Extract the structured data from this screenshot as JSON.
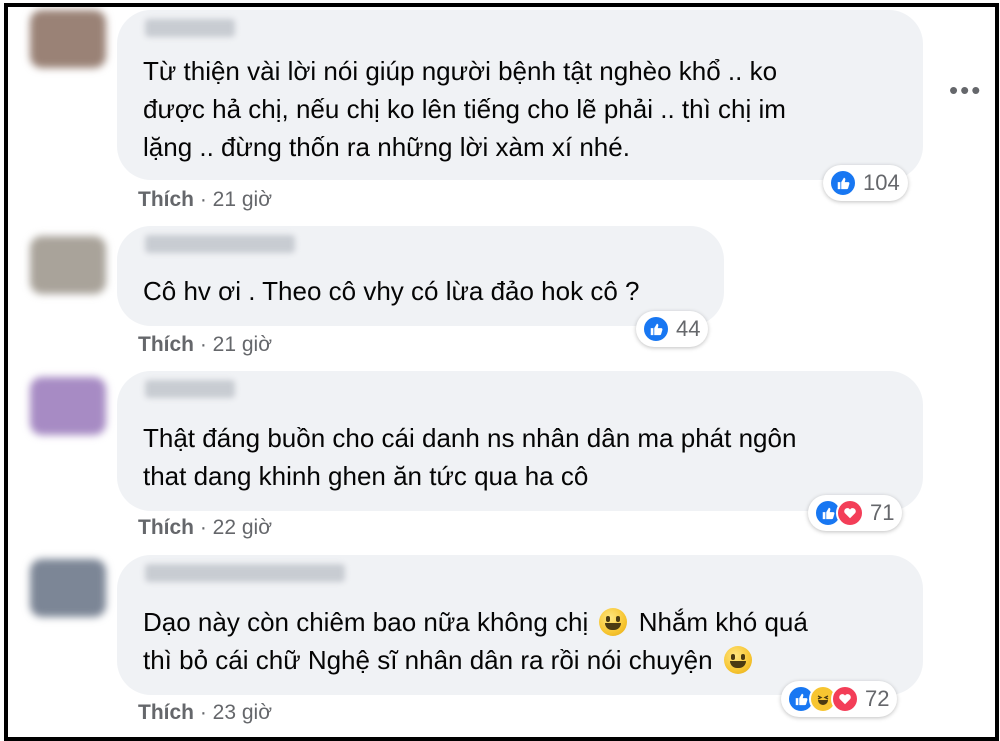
{
  "more_menu": "•••",
  "comments": [
    {
      "text_lines": [
        "Từ thiện vài lời nói giúp người bệnh tật nghèo khổ .. ko",
        "được hả chị, nếu chị ko lên tiếng cho lẽ phải .. thì chị im",
        "lặng .. đừng thốn ra những lời xàm xí nhé."
      ],
      "like_label": "Thích",
      "time": "· 21 giờ",
      "reactions": [
        "like"
      ],
      "reaction_count": "104",
      "avatar_color": "#9a8276"
    },
    {
      "text_lines": [
        "Cô hv ơi . Theo cô vhy có lừa đảo hok cô ?"
      ],
      "like_label": "Thích",
      "time": "· 21 giờ",
      "reactions": [
        "like"
      ],
      "reaction_count": "44",
      "avatar_color": "#a9a39a"
    },
    {
      "text_lines": [
        "Thật đáng buồn cho cái danh ns nhân dân ma phát ngôn",
        "that dang khinh ghen ăn tức qua ha cô"
      ],
      "like_label": "Thích",
      "time": "· 22 giờ",
      "reactions": [
        "like",
        "love"
      ],
      "reaction_count": "71",
      "avatar_color": "#a78bc4"
    },
    {
      "text_lines": [
        "Dạo này còn chiêm bao nữa không chị",
        "Nhắm khó quá",
        "thì bỏ cái chữ Nghệ sĩ nhân dân ra rồi nói chuyện"
      ],
      "like_label": "Thích",
      "time": "· 23 giờ",
      "reactions": [
        "like",
        "haha",
        "love"
      ],
      "reaction_count": "72",
      "avatar_color": "#7c8696"
    }
  ]
}
